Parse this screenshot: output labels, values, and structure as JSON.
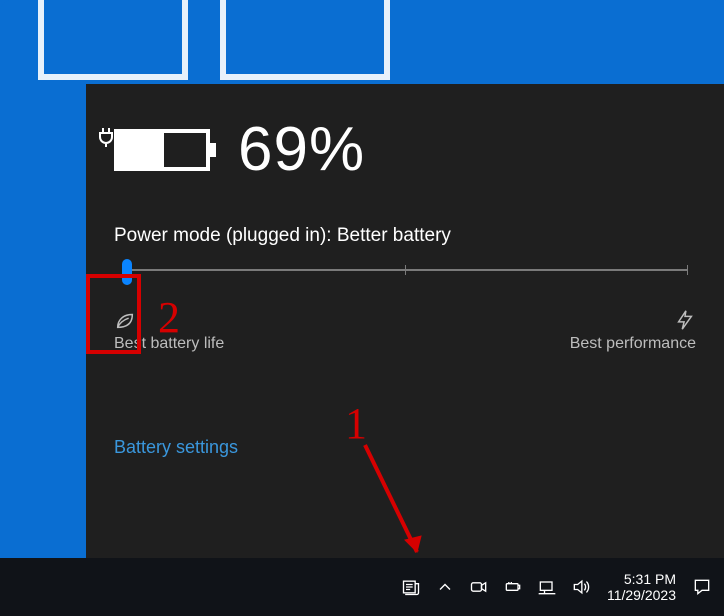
{
  "flyout": {
    "percentage": "69%",
    "mode_line": "Power mode (plugged in): Better battery",
    "slider": {
      "left_label": "Best battery life",
      "right_label": "Best performance"
    },
    "settings_link": "Battery settings"
  },
  "taskbar": {
    "time": "5:31 PM",
    "date": "11/29/2023"
  },
  "annotations": {
    "num1": "1",
    "num2": "2"
  }
}
